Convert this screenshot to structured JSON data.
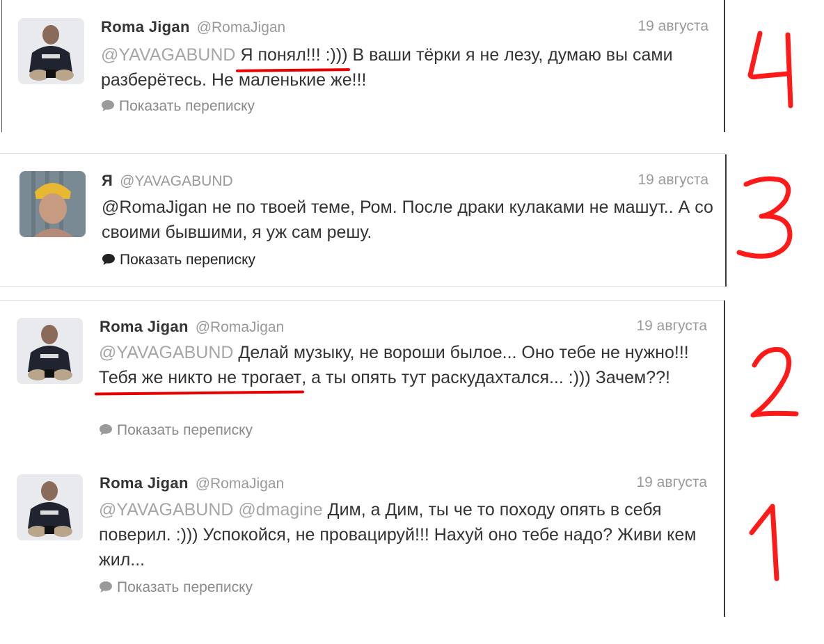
{
  "tweets": [
    {
      "author": "Roma Jigan",
      "handle": "@RomaJigan",
      "date": "19 августа",
      "mention": "@YAVAGABUND",
      "underlined": "Я понял!!! :)))",
      "text_rest": " В ваши тёрки я не лезу, думаю вы сами разберётесь. Не маленькие же!!!",
      "show_conversation": "Показать переписку",
      "number": "4"
    },
    {
      "author": "Я",
      "handle": "@YAVAGABUND",
      "date": "19 августа",
      "text": "@RomaJigan не по твоей теме, Ром. После драки кулаками не машут.. А со своими бывшими, я уж сам решу.",
      "show_conversation": "Показать переписку",
      "number": "3"
    },
    {
      "author": "Roma Jigan",
      "handle": "@RomaJigan",
      "date": "19 августа",
      "mention": "@YAVAGABUND",
      "text_before": " Делай музыку, не вороши былое... Оно тебе не нужно!!! ",
      "underlined": "Тебя же никто не трогает",
      "text_after": ", а ты опять тут раскудахтался... :))) Зачем??!",
      "show_conversation": "Показать переписку",
      "number": "2"
    },
    {
      "author": "Roma Jigan",
      "handle": "@RomaJigan",
      "date": "19 августа",
      "mention": "@YAVAGABUND @dmagine",
      "text_rest": " Дим, а Дим, ты че то походу опять в себя поверил. :))) Успокойся, не провацируй!!! Нахуй оно тебе надо? Живи кем жил...",
      "show_conversation": "Показать переписку",
      "number": "1"
    }
  ],
  "colors": {
    "accent_red": "#e60000",
    "muted": "#9a9a9a"
  }
}
